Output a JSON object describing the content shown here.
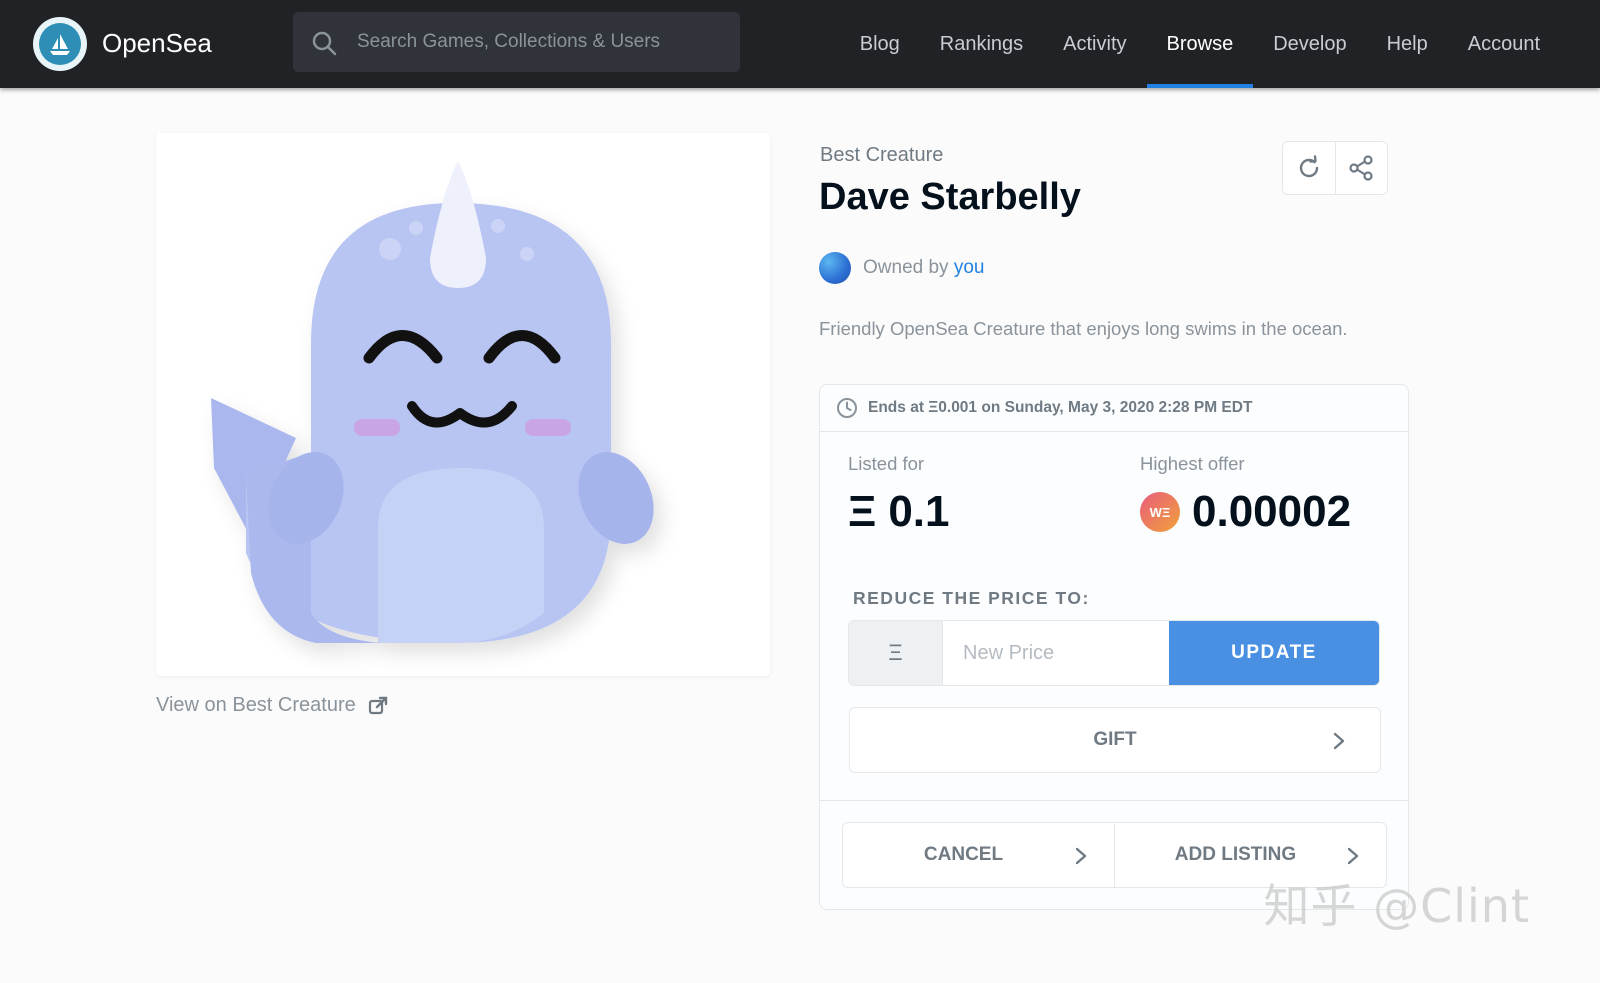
{
  "header": {
    "brand": "OpenSea",
    "search_placeholder": "Search Games, Collections & Users",
    "nav": [
      "Blog",
      "Rankings",
      "Activity",
      "Browse",
      "Develop",
      "Help",
      "Account"
    ],
    "active_nav": "Browse"
  },
  "item": {
    "collection": "Best Creature",
    "name": "Dave Starbelly",
    "owned_by_prefix": "Owned by",
    "owner": "you",
    "description": "Friendly OpenSea Creature that enjoys long swims in the ocean.",
    "view_link": "View on Best Creature"
  },
  "sale": {
    "ends_text": "Ends at Ξ0.001 on Sunday, May 3, 2020 2:28 PM EDT",
    "listed_label": "Listed for",
    "listed_symbol": "Ξ",
    "listed_value": "0.1",
    "offer_label": "Highest offer",
    "offer_token": "WΞ",
    "offer_value": "0.00002",
    "reduce_label": "REDUCE THE PRICE TO:",
    "currency_symbol": "Ξ",
    "price_placeholder": "New Price",
    "update_label": "UPDATE",
    "gift_label": "GIFT",
    "cancel_label": "CANCEL",
    "add_listing_label": "ADD LISTING"
  },
  "watermark": "知乎 @Clint",
  "colors": {
    "header_bg": "#202225",
    "accent": "#2081e2",
    "update_button": "#4a90e2",
    "creature_body": "#b8c4f2"
  }
}
